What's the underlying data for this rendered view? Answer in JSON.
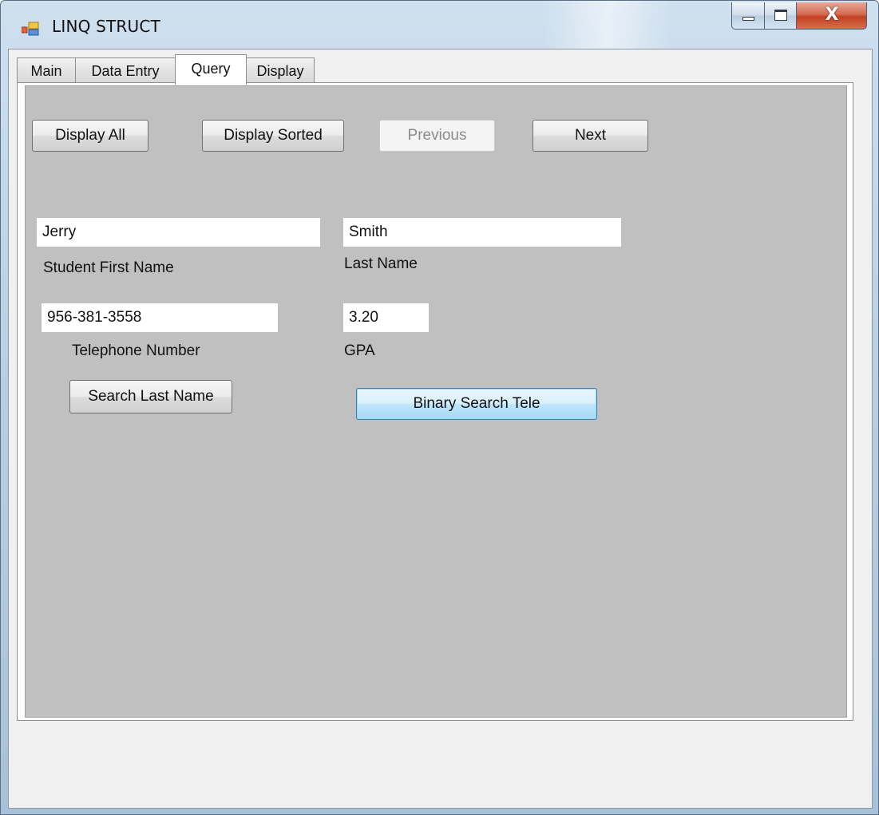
{
  "window": {
    "title": "LINQ STRUCT",
    "caption_buttons": {
      "minimize_icon": "minimize-icon",
      "maximize_icon": "maximize-icon",
      "close_glyph": "X"
    }
  },
  "tabs": [
    {
      "label": "Main",
      "active": false
    },
    {
      "label": "Data Entry",
      "active": false
    },
    {
      "label": "Query",
      "active": true
    },
    {
      "label": "Display",
      "active": false
    }
  ],
  "query_page": {
    "buttons": {
      "display_all": "Display All",
      "display_sorted": "Display Sorted",
      "previous": "Previous",
      "next": "Next",
      "search_last_name": "Search Last Name",
      "binary_search_tele": "Binary Search Tele"
    },
    "fields": {
      "first_name": {
        "value": "Jerry",
        "label": "Student First Name"
      },
      "last_name": {
        "value": "Smith",
        "label": "Last Name"
      },
      "telephone": {
        "value": "956-381-3558",
        "label": "Telephone Number"
      },
      "gpa": {
        "value": "3.20",
        "label": "GPA"
      }
    }
  },
  "colors": {
    "panel_background": "#c0c0c0",
    "client_background": "#f0f0f0",
    "titlebar": "#b9cfe3",
    "close_button": "#c2401f"
  }
}
